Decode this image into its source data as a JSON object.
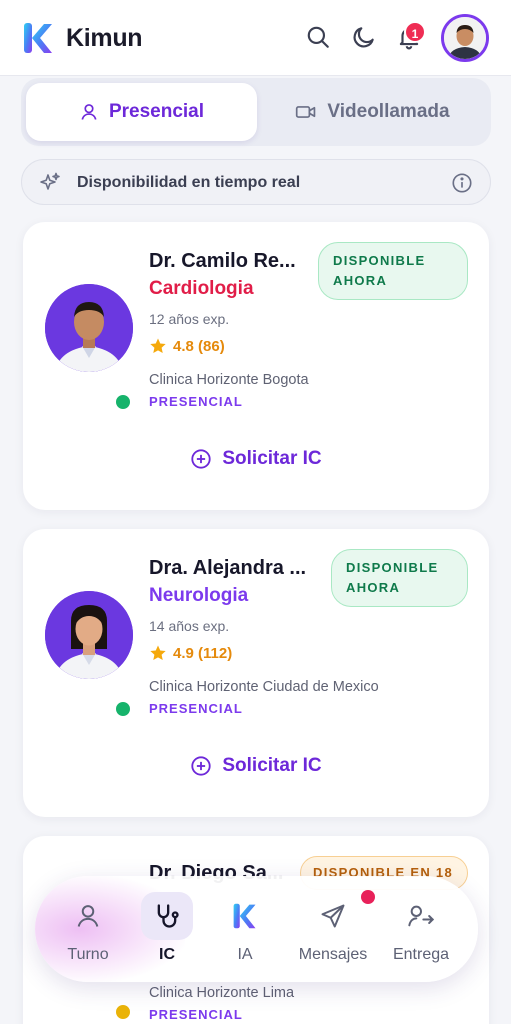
{
  "app": {
    "brand": "Kimun",
    "notifications_count": "1"
  },
  "tabs": {
    "presencial": "Presencial",
    "videollamada": "Videollamada"
  },
  "realtime": {
    "label": "Disponibilidad en tiempo real"
  },
  "doctors": [
    {
      "name": "Dr. Camilo Re...",
      "specialty": "Cardiologia",
      "specialty_color": "#e11d48",
      "experience": "12 años exp.",
      "rating": "4.8 (86)",
      "clinic": "Clinica Horizonte Bogota",
      "mode": "PRESENCIAL",
      "status_line1": "DISPONIBLE",
      "status_line2": "AHORA",
      "status_color": "#0f7a4b",
      "online_color": "#16b36b",
      "action": "Solicitar IC"
    },
    {
      "name": "Dra. Alejandra ...",
      "specialty": "Neurologia",
      "specialty_color": "#7c3aed",
      "experience": "14 años exp.",
      "rating": "4.9 (112)",
      "clinic": "Clinica Horizonte Ciudad de Mexico",
      "mode": "PRESENCIAL",
      "status_line1": "DISPONIBLE",
      "status_line2": "AHORA",
      "status_color": "#0f7a4b",
      "online_color": "#16b36b",
      "action": "Solicitar IC"
    },
    {
      "name": "Dr. Diego Sa...",
      "clinic": "Clinica Horizonte Lima",
      "mode": "PRESENCIAL",
      "status_line1": "DISPONIBLE EN 18",
      "status_color": "#b5600b",
      "online_color": "#eab308"
    }
  ],
  "nav": {
    "items": [
      {
        "label": "Turno",
        "icon": "user-icon"
      },
      {
        "label": "IC",
        "icon": "stethoscope-icon"
      },
      {
        "label": "IA",
        "icon": "kimun-logo-icon"
      },
      {
        "label": "Mensajes",
        "icon": "send-icon"
      },
      {
        "label": "Entrega",
        "icon": "user-arrow-icon"
      }
    ],
    "active": "IC"
  },
  "colors": {
    "accent": "#6d28d9",
    "badge": "#ef2d54"
  }
}
